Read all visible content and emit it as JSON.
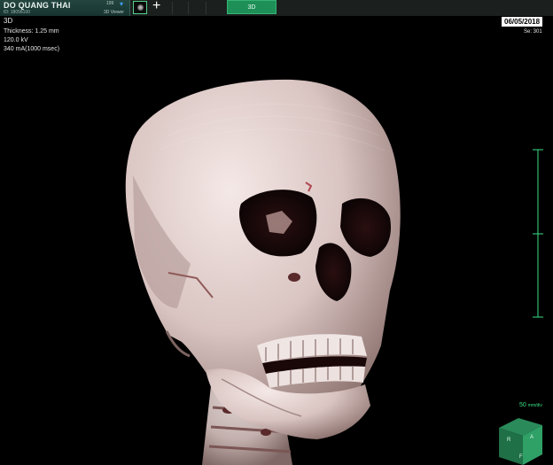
{
  "patient": {
    "name": "DO QUANG THAI",
    "id": "ID: 18058100",
    "series_count": "199",
    "viewer_label": "3D Viewer"
  },
  "toolbar": {
    "add_label": "+",
    "active_tab_label": "3D"
  },
  "viewport": {
    "view_title": "3D",
    "thickness": "Thickness: 1.25 mm",
    "kv": "120.0 kV",
    "ma": "340 mA(1000 msec)",
    "date": "06/05/2018",
    "series": "Se: 301",
    "scale_value": "50",
    "scale_unit": "mm/div",
    "orientation": {
      "right": "R",
      "anterior": "A",
      "feet": "F"
    }
  },
  "colors": {
    "accent_green": "#37e083",
    "tab_green": "#1f8f58",
    "bone": "#e9d9d6"
  },
  "icons": [
    "chevron-down-icon",
    "thumbnail-icon",
    "plus-icon",
    "orientation-cube-icon"
  ]
}
